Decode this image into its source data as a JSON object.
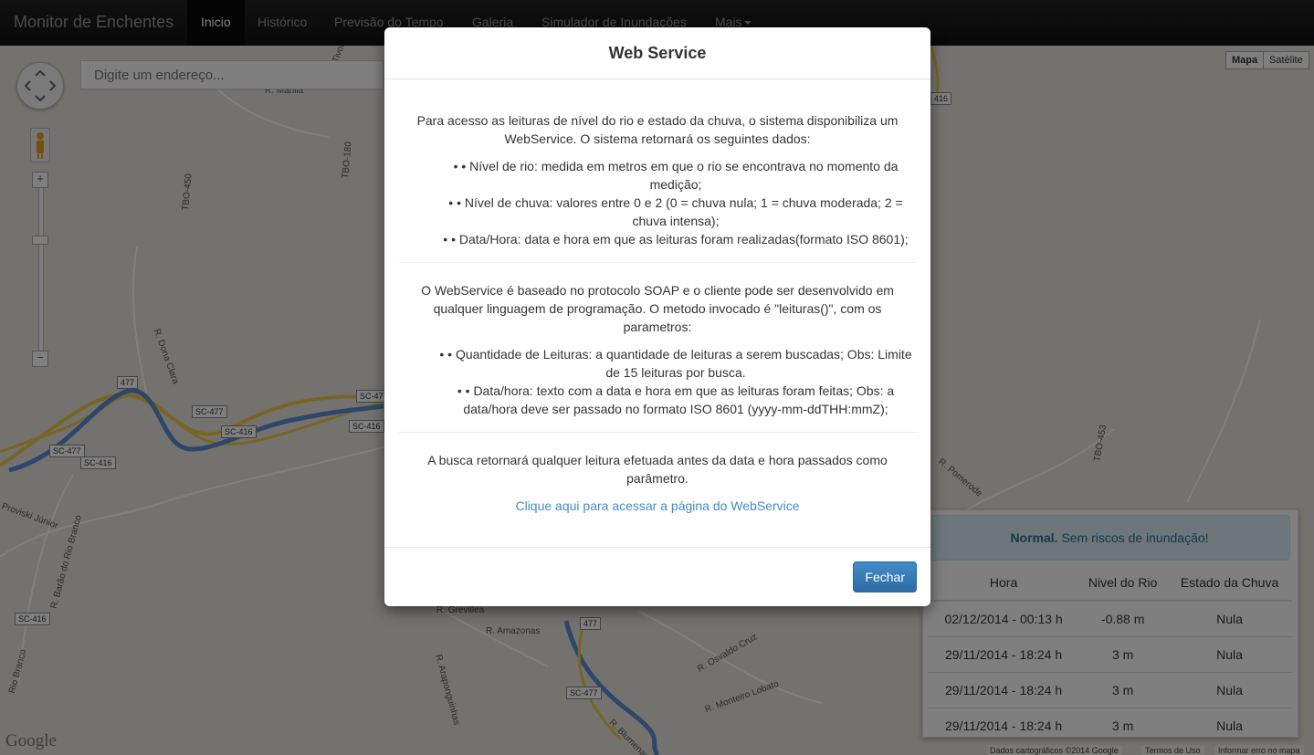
{
  "navbar": {
    "brand": "Monitor de Enchentes",
    "items": [
      {
        "label": "Inicio",
        "active": true
      },
      {
        "label": "Histórico"
      },
      {
        "label": "Previsão do Tempo"
      },
      {
        "label": "Galeria"
      },
      {
        "label": "Simulador de Inundações"
      },
      {
        "label": "Mais"
      }
    ]
  },
  "map": {
    "search_placeholder": "Digite um endereço...",
    "map_types": [
      "Mapa",
      "Satélite"
    ],
    "zoom_in": "+",
    "zoom_out": "−",
    "logo": "Google",
    "attribution": [
      "Dados cartográficos ©2014 Google",
      "Termos de Uso",
      "Informar erro no mapa"
    ],
    "street_labels": [
      "R. Marilia",
      "Tivoli",
      "TBO-450",
      "TBO-180",
      "R. Dona Clara",
      "Proviski Júnior",
      "R. Barão do Rio Branco",
      "Rio Branco",
      "R. Grevillea",
      "R. Amazonas",
      "R. Araponguinhas",
      "R. Osvaldo Cruz",
      "R. Monteiro Lobato",
      "R. Blumenau",
      "TBO-453",
      "R. Pomerode"
    ],
    "road_shields": [
      "477",
      "SC-477",
      "SC-416",
      "SC-477",
      "SC-416",
      "SC-477",
      "SC-416",
      "SC-416",
      "477",
      "SC-477",
      "416"
    ]
  },
  "status": {
    "alert_strong": "Normal.",
    "alert_text": " Sem riscos de inundação!",
    "columns": [
      "Hora",
      "Nivel do Rio",
      "Estado da Chuva"
    ],
    "rows": [
      [
        "02/12/2014 - 00:13 h",
        "-0.88 m",
        "Nula"
      ],
      [
        "29/11/2014 - 18:24 h",
        "3 m",
        "Nula"
      ],
      [
        "29/11/2014 - 18:24 h",
        "3 m",
        "Nula"
      ],
      [
        "29/11/2014 - 18:24 h",
        "3 m",
        "Nula"
      ]
    ]
  },
  "modal": {
    "title": "Web Service",
    "intro": "Para acesso as leituras de nível do rio e estado da chuva, o sistema disponibiliza um WebService. O sistema retornará os seguintes dados:",
    "data_items": [
      "• Nível de rio: medida em metros em que o rio se encontrava no momento da medição;",
      "• Nível de chuva: valores entre 0 e 2 (0 = chuva nula; 1 = chuva moderada; 2 = chuva intensa);",
      "• Data/Hora: data e hora em que as leituras foram realizadas(formato ISO 8601);"
    ],
    "protocol": "O WebService é baseado no protocolo SOAP e o cliente pode ser desenvolvido em qualquer linguagem de programação. O metodo invocado é \"leituras()\", com os parametros:",
    "param_items": [
      "• Quantidade de Leituras: a quantidade de leituras a serem buscadas; Obs: Limite de 15 leituras por busca.",
      "• Data/hora: texto com a data e hora em que as leituras foram feitas; Obs: a data/hora deve ser passado no formato ISO 8601 (yyyy-mm-ddTHH:mmZ);"
    ],
    "search_note": "A busca retornará qualquer leitura efetuada antes da data e hora passados como parâmetro.",
    "link_text": "Clique aqui para acessar a página do WebService",
    "close_label": "Fechar"
  }
}
